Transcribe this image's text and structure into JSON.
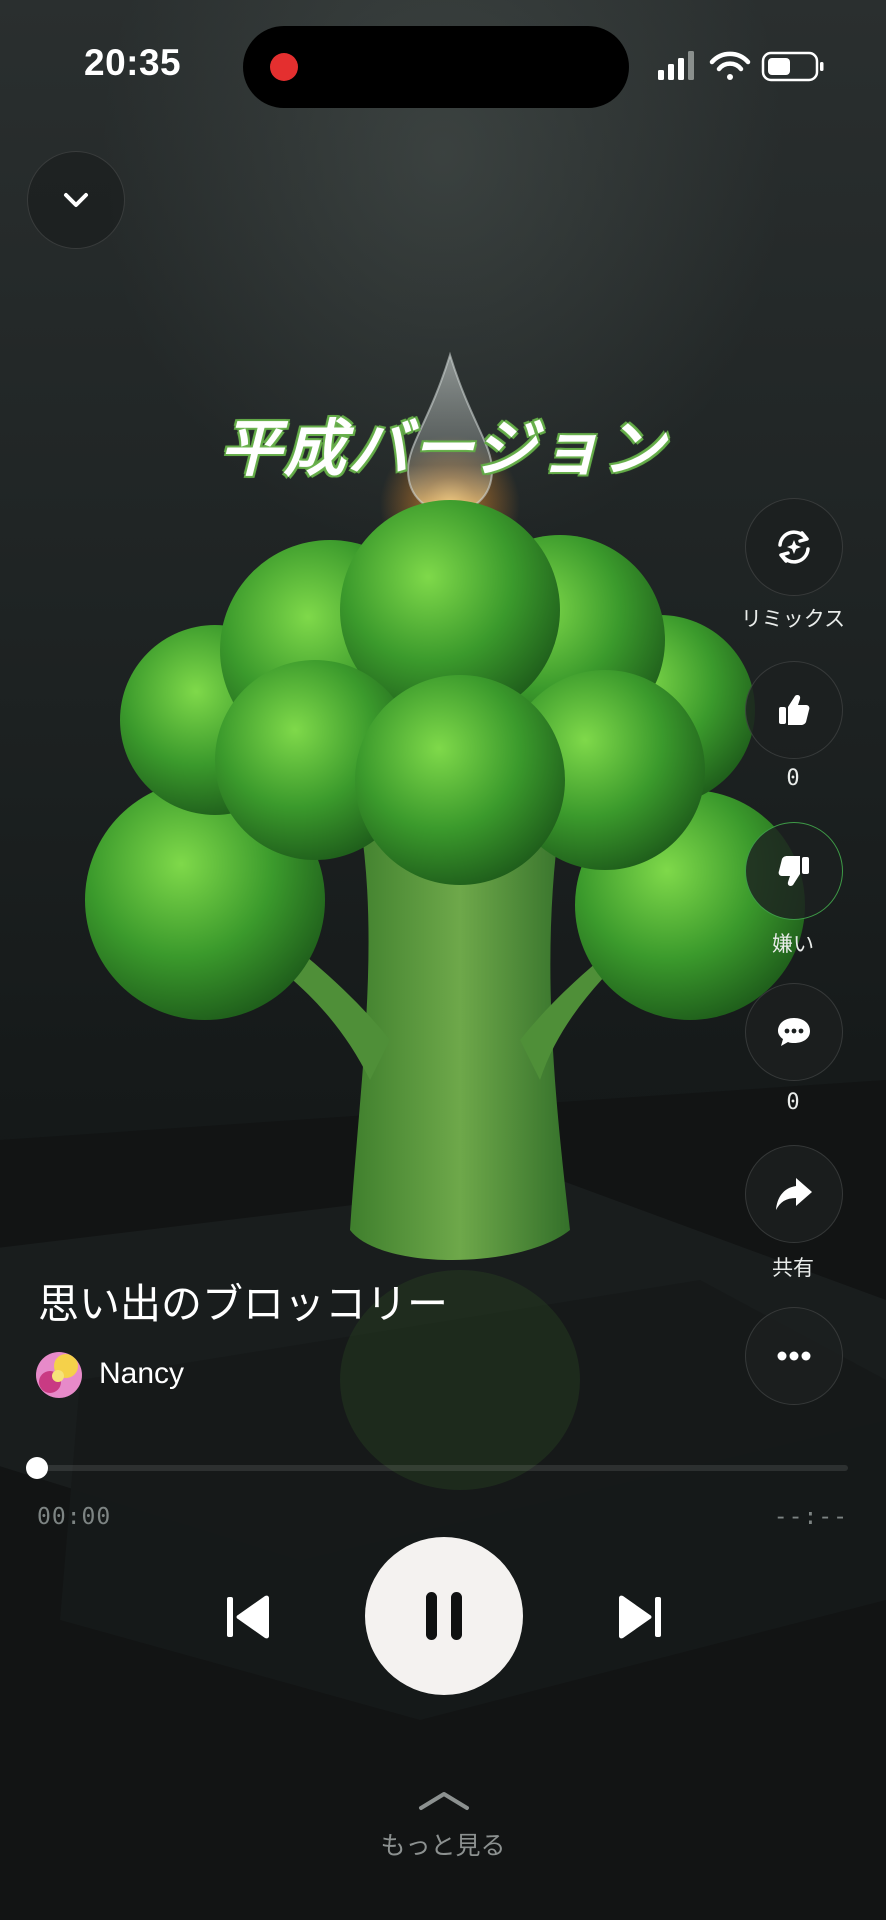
{
  "status_bar": {
    "time": "20:35"
  },
  "artwork": {
    "title_text": "平成バージョン"
  },
  "actions": {
    "remix_label": "リミックス",
    "like_count": "0",
    "dislike_label": "嫌い",
    "comment_count": "0",
    "share_label": "共有"
  },
  "song": {
    "title": "思い出のブロッコリー",
    "artist": "Nancy"
  },
  "player": {
    "current_time": "00:00",
    "duration": "--:--",
    "progress": 0.0,
    "state": "playing"
  },
  "footer": {
    "more_label": "もっと見る"
  },
  "icons": {
    "collapse": "chevron-down-icon",
    "remix": "remix-icon",
    "like": "thumbs-up-icon",
    "dislike": "thumbs-down-icon",
    "comment": "comment-icon",
    "share": "share-icon",
    "more": "more-icon",
    "prev": "skip-previous-icon",
    "pause": "pause-icon",
    "next": "skip-next-icon",
    "expand": "chevron-up-icon"
  },
  "colors": {
    "accent_green": "#4caf50",
    "record_red": "#e42f2f"
  }
}
